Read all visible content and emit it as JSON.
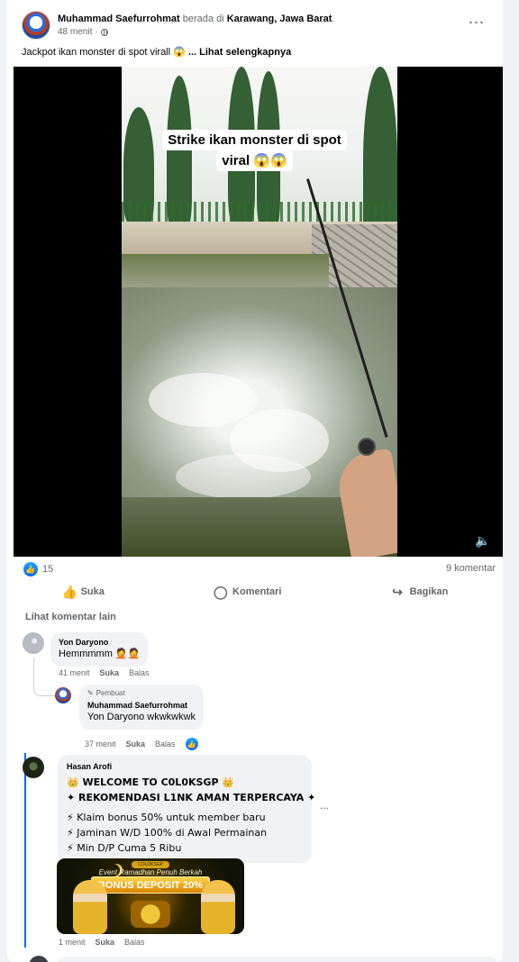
{
  "post": {
    "author": "Muhammad Saefurrohmat",
    "location_prefix": " berada di ",
    "location": "Karawang, Jawa Barat",
    "location_suffix": ".",
    "time": "48 menit",
    "time_sep": "·",
    "caption": "Jackpot ikan monster di spot virall 😱 ",
    "see_more": "... Lihat selengkapnya",
    "more_icon": "more-horizontal-icon"
  },
  "video": {
    "overlay_line1": "Strike ikan monster di spot",
    "overlay_line2": "viral 😱😱",
    "volume_icon": "volume-icon"
  },
  "stats": {
    "reactions": "15",
    "comments": "9 komentar"
  },
  "actions": {
    "like": "Suka",
    "comment": "Komentari",
    "share": "Bagikan"
  },
  "comments_section": {
    "see_more": "Lihat komentar lain",
    "comments": [
      {
        "name": "Yon Daryono",
        "text": "Hemmmmm 🤦🤦",
        "time": "41 menit",
        "like": "Suka",
        "reply": "Balas"
      },
      {
        "badge": "Pembuat",
        "name": "Muhammad Saefurrohmat",
        "mention": "Yon Daryono",
        "text": " wkwkwkwk",
        "time": "37 menit",
        "like": "Suka",
        "reply": "Balas"
      },
      {
        "name": "Hasan Arofi",
        "lines": [
          "👑 WELCOME TO C0L0KSGP 👑",
          "✦ REKOMENDASI L1NK AMAN TERPERCAYA ✦",
          "⚡ Klaim bonus 50% untuk member baru",
          "⚡ Jaminan W/D 100% di Awal Permainan",
          "⚡ Min D/P Cuma 5 Ribu"
        ],
        "more": "...",
        "promo_brand": "COLOKSGP",
        "promo_top": "Event Ramadhan Penuh Berkah",
        "promo_title": "BONUS DEPOSIT 20%",
        "time": "1 menit",
        "like": "Suka",
        "reply": "Balas"
      }
    ]
  },
  "colors": {
    "accent": "#0866ff",
    "muted_text": "#65676b",
    "bubble": "#f0f2f5"
  }
}
